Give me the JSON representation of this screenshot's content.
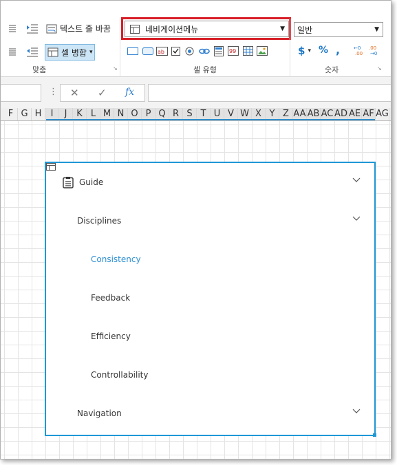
{
  "ribbon": {
    "wrap_text_label": "텍스트 줄 바꿈",
    "merge_cells_label": "셀 병합",
    "merge_dropdown": "▾",
    "group_alignment": "맞춤",
    "cell_type_combo_value": "네비게이션메뉴",
    "group_cell_type": "셀 유형",
    "number_format_value": "일반",
    "currency_symbol": "$",
    "currency_dropdown": "▾",
    "percent_symbol": "%",
    "comma_symbol": ",",
    "group_number": "숫자",
    "launcher": "↘",
    "cell_type_icons": [
      "textbox-icon",
      "button-icon",
      "label-icon",
      "checkbox-icon",
      "radio-icon",
      "hyperlink-icon",
      "list-icon",
      "number-icon",
      "grid-icon",
      "image-icon"
    ]
  },
  "formula_bar": {
    "menu_dots": "⋮",
    "cancel": "✕",
    "confirm": "✓",
    "fx": "fx",
    "name_box": "",
    "formula": ""
  },
  "columns": [
    "F",
    "G",
    "H",
    "I",
    "J",
    "K",
    "L",
    "M",
    "N",
    "O",
    "P",
    "Q",
    "R",
    "S",
    "T",
    "U",
    "V",
    "W",
    "X",
    "Y",
    "Z",
    "AA",
    "AB",
    "AC",
    "AD",
    "AE",
    "AF",
    "AG"
  ],
  "selected_columns": [
    "I",
    "J",
    "K",
    "L",
    "M",
    "N",
    "O",
    "P",
    "Q",
    "R",
    "S",
    "T",
    "U",
    "V",
    "W",
    "X",
    "Y",
    "Z",
    "AA",
    "AB",
    "AC",
    "AD",
    "AE",
    "AF"
  ],
  "nav_menu": {
    "items": [
      {
        "label": "Guide",
        "level": 0,
        "expandable": true,
        "icon": "clipboard-icon"
      },
      {
        "label": "Disciplines",
        "level": 1,
        "expandable": true
      },
      {
        "label": "Consistency",
        "level": 2,
        "expandable": false,
        "active": true
      },
      {
        "label": "Feedback",
        "level": 2,
        "expandable": false
      },
      {
        "label": "Efficiency",
        "level": 2,
        "expandable": false
      },
      {
        "label": "Controllability",
        "level": 2,
        "expandable": false
      },
      {
        "label": "Navigation",
        "level": 1,
        "expandable": true
      }
    ],
    "active_color": "#2b8ed3",
    "border_color": "#1f97d6"
  },
  "colors": {
    "highlight_border": "#d81e26",
    "accent": "#2f8fcb",
    "number_blue": "#1f7ac8",
    "number_orange": "#e06b1f"
  }
}
